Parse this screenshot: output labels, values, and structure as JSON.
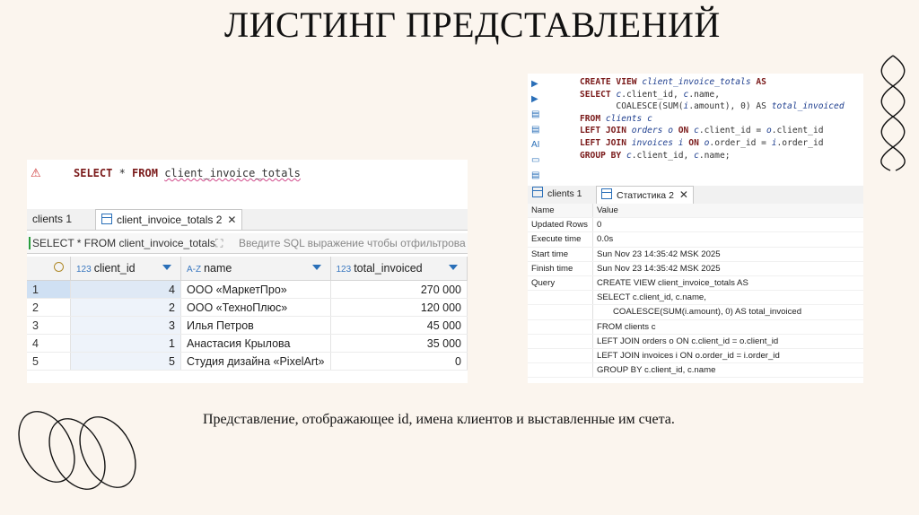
{
  "slide": {
    "title": "ЛИСТИНГ ПРЕДСТАВЛЕНИЙ",
    "caption": "Представление, отображающее id, имена клиентов и выставленные им счета."
  },
  "left_panel": {
    "editor": {
      "kw1": "SELECT",
      "star": " * ",
      "kw2": "FROM",
      "view": "client_invoice_totals"
    },
    "tabs": [
      {
        "label": "clients 1"
      },
      {
        "label": "client_invoice_totals 2"
      }
    ],
    "filter": {
      "query": "SELECT * FROM client_invoice_totals",
      "placeholder": "Введите SQL выражение чтобы отфильтрова"
    },
    "columns": [
      {
        "type": "123",
        "name": "client_id"
      },
      {
        "type": "A-Z",
        "name": "name"
      },
      {
        "type": "123",
        "name": "total_invoiced"
      }
    ],
    "rows": [
      {
        "n": "1",
        "client_id": "4",
        "name": "ООО «МаркетПро»",
        "total": "270 000"
      },
      {
        "n": "2",
        "client_id": "2",
        "name": "ООО «ТехноПлюс»",
        "total": "120 000"
      },
      {
        "n": "3",
        "client_id": "3",
        "name": "Илья Петров",
        "total": "45 000"
      },
      {
        "n": "4",
        "client_id": "1",
        "name": "Анастасия Крылова",
        "total": "35 000"
      },
      {
        "n": "5",
        "client_id": "5",
        "name": "Студия дизайна «PixelArt»",
        "total": "0"
      }
    ]
  },
  "right_panel": {
    "code": {
      "l1a": "CREATE VIEW ",
      "l1b": "client_invoice_totals",
      "l1c": " AS",
      "l2a": "SELECT ",
      "l2b": "c",
      "l2c": ".client_id, ",
      "l2d": "c",
      "l2e": ".name,",
      "l3a": "       COALESCE(SUM(",
      "l3b": "i",
      "l3c": ".amount), 0) AS ",
      "l3d": "total_invoiced",
      "l4a": "FROM ",
      "l4b": "clients c",
      "l5a": "LEFT JOIN ",
      "l5b": "orders o",
      "l5c": " ON ",
      "l5d": "c",
      "l5e": ".client_id = ",
      "l5f": "o",
      "l5g": ".client_id",
      "l6a": "LEFT JOIN ",
      "l6b": "invoices i",
      "l6c": " ON ",
      "l6d": "o",
      "l6e": ".order_id = ",
      "l6f": "i",
      "l6g": ".order_id",
      "l7a": "GROUP BY ",
      "l7b": "c",
      "l7c": ".client_id, ",
      "l7d": "c",
      "l7e": ".name;"
    },
    "icons": [
      "run-icon",
      "run-script-icon",
      "explain-icon",
      "history-icon",
      "ai-icon",
      "terminal-icon",
      "format-icon"
    ],
    "tabs": [
      {
        "label": "clients 1"
      },
      {
        "label": "Статистика 2"
      }
    ],
    "stats_header": {
      "name": "Name",
      "value": "Value"
    },
    "stats": [
      {
        "k": "Updated Rows",
        "v": "0"
      },
      {
        "k": "Execute time",
        "v": "0.0s"
      },
      {
        "k": "Start time",
        "v": "Sun Nov 23 14:35:42 MSK 2025"
      },
      {
        "k": "Finish time",
        "v": "Sun Nov 23 14:35:42 MSK 2025"
      },
      {
        "k": "Query",
        "v": "CREATE VIEW client_invoice_totals AS"
      }
    ],
    "query_lines": [
      {
        "t": "SELECT c.client_id, c.name,",
        "indent": "1"
      },
      {
        "t": "COALESCE(SUM(i.amount), 0) AS total_invoiced",
        "indent": "2"
      },
      {
        "t": "FROM clients c",
        "indent": "1"
      },
      {
        "t": "LEFT JOIN orders o ON c.client_id = o.client_id",
        "indent": "1"
      },
      {
        "t": "LEFT JOIN invoices i ON o.order_id = i.order_id",
        "indent": "1"
      },
      {
        "t": "GROUP BY c.client_id, c.name",
        "indent": "1"
      }
    ]
  }
}
